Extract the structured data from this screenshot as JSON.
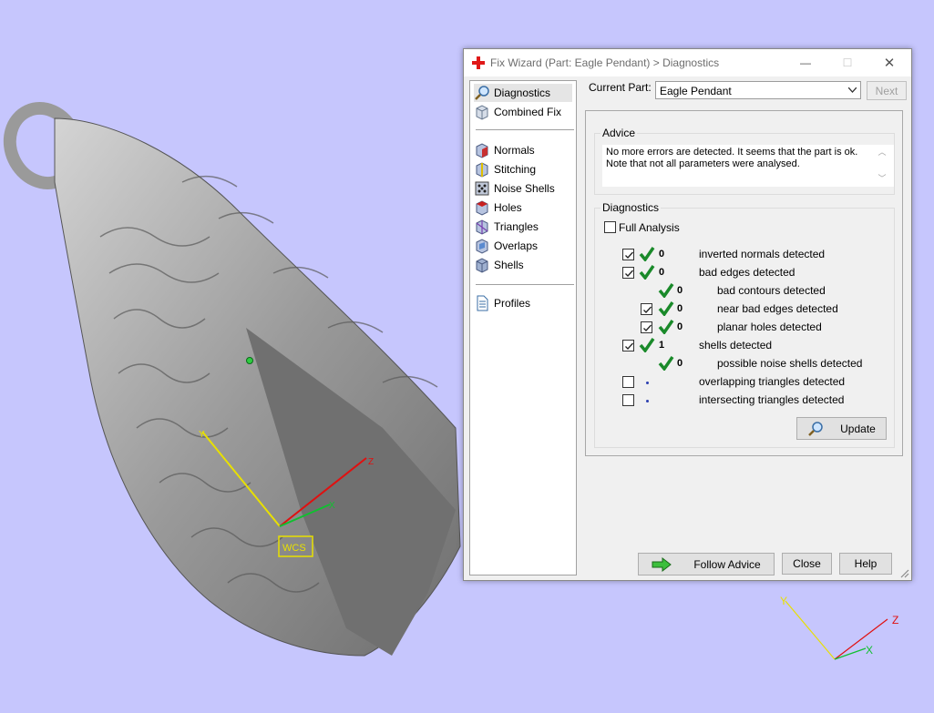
{
  "window": {
    "title": "Fix Wizard (Part: Eagle Pendant) > Diagnostics",
    "minimize_label": "—",
    "maximize_label": "☐",
    "close_label": "✕"
  },
  "sidebar": {
    "items": [
      {
        "label": "Diagnostics",
        "icon": "magnifier-icon"
      },
      {
        "label": "Combined Fix",
        "icon": "cube-stack-icon"
      },
      {
        "label": "Normals",
        "icon": "normals-cube-icon"
      },
      {
        "label": "Stitching",
        "icon": "stitching-cube-icon"
      },
      {
        "label": "Noise Shells",
        "icon": "noise-shells-icon"
      },
      {
        "label": "Holes",
        "icon": "holes-cube-icon"
      },
      {
        "label": "Triangles",
        "icon": "triangles-icon"
      },
      {
        "label": "Overlaps",
        "icon": "overlaps-icon"
      },
      {
        "label": "Shells",
        "icon": "shells-icon"
      },
      {
        "label": "Profiles",
        "icon": "profiles-document-icon"
      }
    ]
  },
  "part": {
    "label": "Current Part:",
    "value": "Eagle Pendant",
    "next_label": "Next"
  },
  "advice": {
    "title": "Advice",
    "line1": "No more errors are detected. It seems that the part is ok.",
    "line2": "Note that not all parameters were analysed."
  },
  "diagnostics": {
    "title": "Diagnostics",
    "full_analysis_label": "Full Analysis",
    "rows": [
      {
        "checked": true,
        "count": "0",
        "label": "inverted normals detected"
      },
      {
        "checked": true,
        "count": "0",
        "label": "bad edges detected"
      },
      {
        "checked": null,
        "count": "0",
        "label": "bad contours detected"
      },
      {
        "checked": true,
        "count": "0",
        "label": "near bad edges detected"
      },
      {
        "checked": true,
        "count": "0",
        "label": "planar holes detected"
      },
      {
        "checked": true,
        "count": "1",
        "label": "shells detected"
      },
      {
        "checked": null,
        "count": "0",
        "label": "possible noise shells detected"
      },
      {
        "checked": false,
        "count": "",
        "label": "overlapping triangles detected"
      },
      {
        "checked": false,
        "count": "",
        "label": "intersecting triangles detected"
      }
    ],
    "update_label": "Update"
  },
  "footer": {
    "follow_advice_label": "Follow Advice",
    "close_label": "Close",
    "help_label": "Help"
  },
  "viewport": {
    "wcs_label": "WCS",
    "axis_x": "X",
    "axis_y": "Y",
    "axis_z": "Z",
    "triad_x": "X",
    "triad_y": "Y",
    "triad_z": "Z"
  },
  "colors": {
    "background": "#c6c6fd",
    "check_green": "#1a8a2a",
    "axis_red": "#e01010",
    "axis_yellow": "#e8e000",
    "axis_green": "#10c030"
  }
}
